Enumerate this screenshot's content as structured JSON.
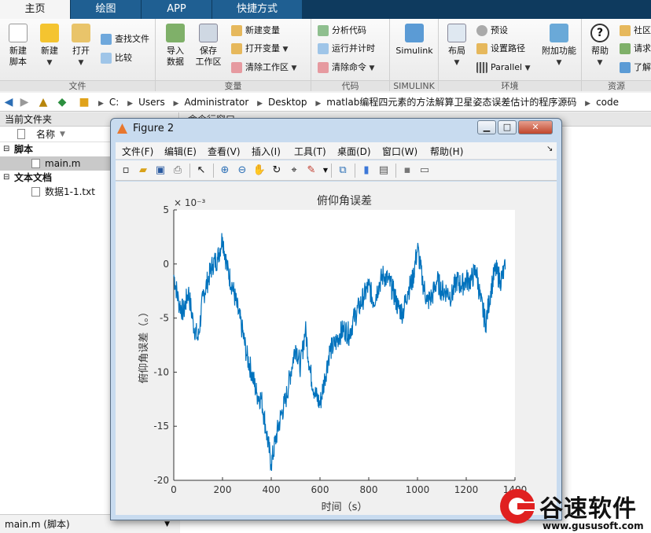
{
  "tabs": [
    {
      "label": "主页",
      "active": true
    },
    {
      "label": "绘图",
      "active": false
    },
    {
      "label": "APP",
      "active": false
    },
    {
      "label": "快捷方式",
      "active": false
    }
  ],
  "ribbon": {
    "file_group": {
      "label": "文件",
      "new_script": "新建\n脚本",
      "new": "新建",
      "open": "打开",
      "find_files": "查找文件",
      "compare": "比较"
    },
    "variable_group": {
      "label": "变量",
      "import_data": "导入\n数据",
      "save_workspace": "保存\n工作区",
      "new_variable": "新建变量",
      "open_variable": "打开变量",
      "clear_workspace": "清除工作区"
    },
    "code_group": {
      "label": "代码",
      "analyze_code": "分析代码",
      "run_and_time": "运行并计时",
      "clear_commands": "清除命令"
    },
    "simulink_group": {
      "label": "SIMULINK",
      "simulink": "Simulink"
    },
    "env_group": {
      "label": "环境",
      "layout": "布局",
      "preferences": "预设",
      "set_path": "设置路径",
      "parallel": "Parallel",
      "addons": "附加功能"
    },
    "resources_group": {
      "label": "资源",
      "help": "帮助",
      "community": "社区",
      "request": "请求",
      "learn": "了解"
    }
  },
  "address_bar": {
    "crumbs": [
      "C:",
      "Users",
      "Administrator",
      "Desktop",
      "matlab编程四元素的方法解算卫星姿态误差估计的程序源码",
      "code"
    ]
  },
  "current_folder": {
    "title": "当前文件夹",
    "column_name": "名称",
    "groups": [
      {
        "label": "脚本",
        "items": [
          "main.m"
        ]
      },
      {
        "label": "文本文档",
        "items": [
          "数据1-1.txt"
        ]
      }
    ],
    "footer": "main.m  (脚本)"
  },
  "command_window": {
    "title": "命令行窗口"
  },
  "figure": {
    "title": "Figure 2",
    "menus": [
      "文件(F)",
      "编辑(E)",
      "查看(V)",
      "插入(I)",
      "工具(T)",
      "桌面(D)",
      "窗口(W)",
      "帮助(H)"
    ]
  },
  "chart_data": {
    "type": "line",
    "title": "俯仰角误差",
    "xlabel": "时间（s）",
    "ylabel": "俯仰角误差（。）",
    "exponent_label": "× 10⁻³",
    "xlim": [
      0,
      1400
    ],
    "ylim": [
      -20,
      5
    ],
    "xticks": [
      0,
      200,
      400,
      600,
      800,
      1000,
      1200,
      1400
    ],
    "yticks": [
      5,
      0,
      -5,
      -10,
      -15,
      -20
    ],
    "color": "#0072bd",
    "grid": false,
    "series": [
      {
        "x": [
          0,
          20,
          40,
          60,
          80,
          100,
          120,
          140,
          160,
          180,
          200,
          220,
          240,
          260,
          280,
          300,
          320,
          340,
          360,
          380,
          400,
          420,
          440,
          460,
          480,
          500,
          520,
          540,
          560,
          580,
          600,
          620,
          640,
          660,
          680,
          700,
          720,
          740,
          760,
          780,
          800,
          820,
          840,
          860,
          880,
          900,
          920,
          940,
          960,
          980,
          1000,
          1020,
          1040,
          1060,
          1080,
          1100,
          1120,
          1140,
          1160,
          1180,
          1200,
          1220,
          1240,
          1260,
          1280,
          1300,
          1320,
          1340,
          1360
        ],
        "values": [
          -1,
          -3.5,
          -4.5,
          -2.5,
          -5.5,
          -7,
          -3,
          -1.5,
          0,
          0.5,
          2.5,
          -0.5,
          -2,
          -4,
          -6,
          -8.5,
          -10,
          -12,
          -12.5,
          -15.5,
          -18.5,
          -16,
          -14,
          -12.5,
          -10,
          -7.5,
          -9.5,
          -6,
          -10,
          -12,
          -13,
          -10.5,
          -8,
          -7.5,
          -6.5,
          -6,
          -6.5,
          -5,
          -4,
          -3,
          -2,
          -3.5,
          -2,
          -1,
          -1.5,
          -2.5,
          -4,
          -4.5,
          -2.5,
          -1.5,
          1.5,
          -1.5,
          -3.5,
          -3,
          -1.5,
          -2.5,
          -2.5,
          -3,
          -1.5,
          -2,
          -1.5,
          -1.5,
          -0.5,
          -3.5,
          -5.5,
          -2.5,
          -0.5,
          -1.5,
          -0.5
        ]
      }
    ]
  },
  "watermark": {
    "name": "谷速软件",
    "url": "www.gususoft.com"
  }
}
